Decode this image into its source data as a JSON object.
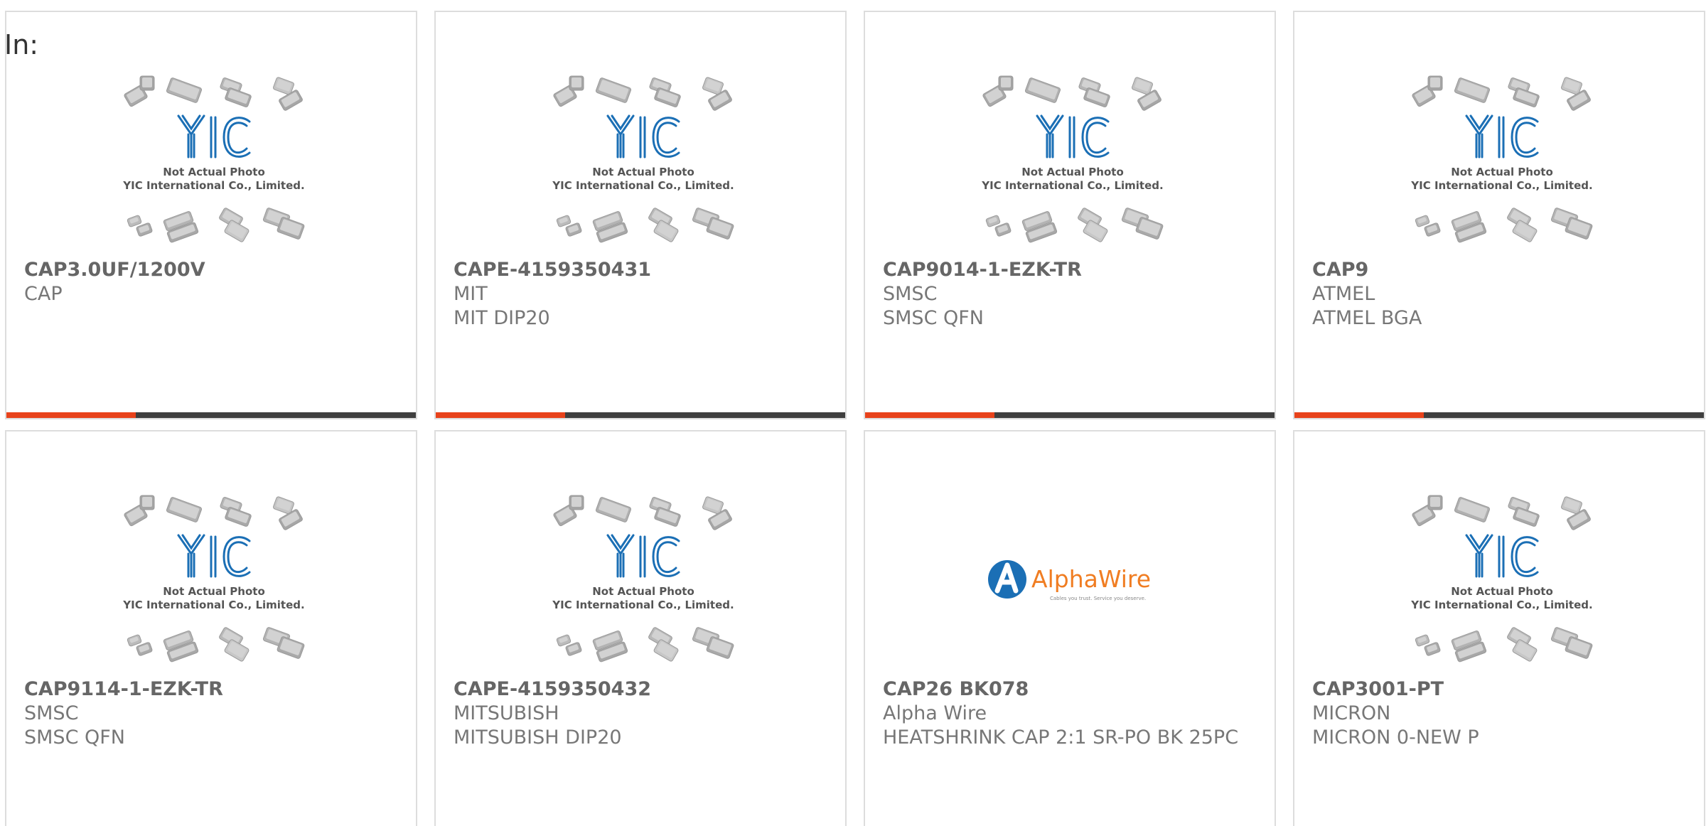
{
  "filter": {
    "label": "In:"
  },
  "colors": {
    "accent": "#e8421b",
    "bar": "#3f3f3f",
    "border": "#dddddd",
    "logo_blue": "#1b6fb5",
    "alpha_orange": "#f07d22"
  },
  "placeholder_image": {
    "icon": "chip-packages-placeholder-icon",
    "caption_1": "Not Actual Photo",
    "caption_2": "YIC International Co., Limited."
  },
  "products": [
    {
      "part_no": "CAP3.0UF/1200V",
      "manufacturer": "CAP",
      "description": "",
      "image": "placeholder"
    },
    {
      "part_no": "CAPE-4159350431",
      "manufacturer": "MIT",
      "description": "MIT DIP20",
      "image": "placeholder"
    },
    {
      "part_no": "CAP9014-1-EZK-TR",
      "manufacturer": "SMSC",
      "description": "SMSC QFN",
      "image": "placeholder"
    },
    {
      "part_no": "CAP9",
      "manufacturer": "ATMEL",
      "description": "ATMEL BGA",
      "image": "placeholder"
    },
    {
      "part_no": "CAP9114-1-EZK-TR",
      "manufacturer": "SMSC",
      "description": "SMSC QFN",
      "image": "placeholder"
    },
    {
      "part_no": "CAPE-4159350432",
      "manufacturer": "MITSUBISH",
      "description": "MITSUBISH DIP20",
      "image": "placeholder"
    },
    {
      "part_no": "CAP26 BK078",
      "manufacturer": "Alpha Wire",
      "description": "HEATSHRINK CAP 2:1 SR-PO BK 25PC",
      "image": "alphawire"
    },
    {
      "part_no": "CAP3001-PT",
      "manufacturer": "MICRON",
      "description": "MICRON 0-NEW P",
      "image": "placeholder"
    }
  ],
  "alphawire_logo": {
    "icon": "alphawire-logo-icon",
    "wordmark": "AlphaWire",
    "tagline": "Cables you trust. Service you deserve."
  }
}
